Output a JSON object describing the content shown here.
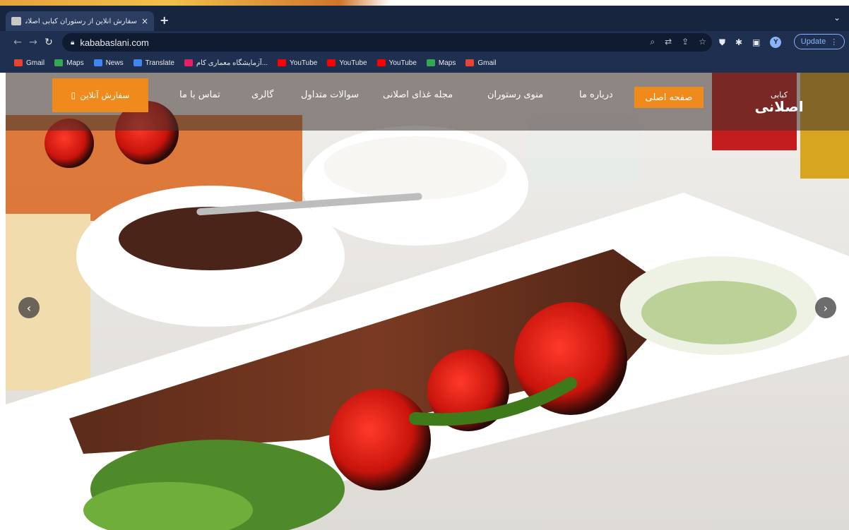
{
  "browser": {
    "tab_title": "سفارش آنلاین از رستوران کبابی اصلانی",
    "tab_close": "×",
    "new_tab": "+",
    "tab_menu": "⌄",
    "url": "kababaslani.com",
    "update_label": "Update",
    "avatar_letter": "Y",
    "bookmarks": [
      {
        "label": "Gmail",
        "color": "#ea4335"
      },
      {
        "label": "Maps",
        "color": "#34a853"
      },
      {
        "label": "News",
        "color": "#4285f4"
      },
      {
        "label": "Translate",
        "color": "#4285f4"
      },
      {
        "label": "آزمایشگاه معماری کام...",
        "color": "#e91e63"
      },
      {
        "label": "YouTube",
        "color": "#ff0000"
      },
      {
        "label": "YouTube",
        "color": "#ff0000"
      },
      {
        "label": "YouTube",
        "color": "#ff0000"
      },
      {
        "label": "Maps",
        "color": "#34a853"
      },
      {
        "label": "Gmail",
        "color": "#ea4335"
      }
    ]
  },
  "site": {
    "order_button": "سفارش آنلاین",
    "nav": {
      "contact": "تماس با ما",
      "gallery": "گالری",
      "faq": "سوالات متداول",
      "magazine": "مجله غذای اصلانی",
      "menu": "منوی رستوران",
      "about": "درباره ما",
      "home": "صفحه اصلی"
    },
    "logo_small": "کبابی",
    "logo_big": "اصلانی",
    "prev_arrow": "‹",
    "next_arrow": "›",
    "accent_color": "#f08a1c"
  }
}
